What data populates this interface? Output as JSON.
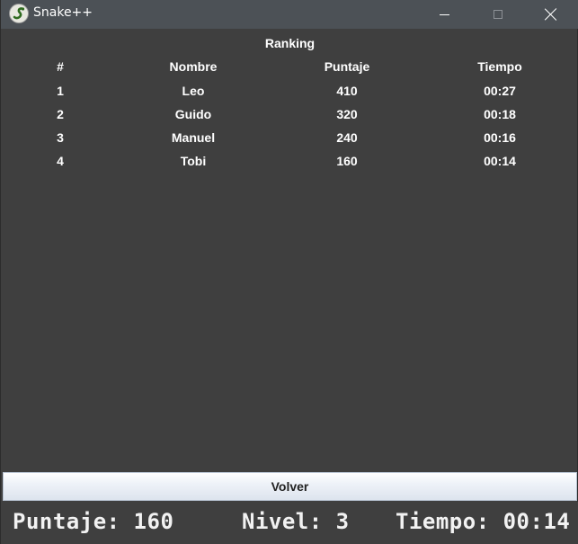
{
  "window": {
    "title": "Snake++",
    "icon": "snake-app-icon"
  },
  "ranking": {
    "title": "Ranking",
    "headers": [
      "#",
      "Nombre",
      "Puntaje",
      "Tiempo"
    ],
    "rows": [
      [
        "1",
        "Leo",
        "410",
        "00:27"
      ],
      [
        "2",
        "Guido",
        "320",
        "00:18"
      ],
      [
        "3",
        "Manuel",
        "240",
        "00:16"
      ],
      [
        "4",
        "Tobi",
        "160",
        "00:14"
      ]
    ]
  },
  "buttons": {
    "back": "Volver"
  },
  "status": {
    "score": "Puntaje: 160",
    "level": "Nivel: 3",
    "time": "Tiempo: 00:14"
  },
  "colors": {
    "background": "#3f3f3f",
    "titlebar": "#4c5156",
    "text": "#ffffff"
  }
}
